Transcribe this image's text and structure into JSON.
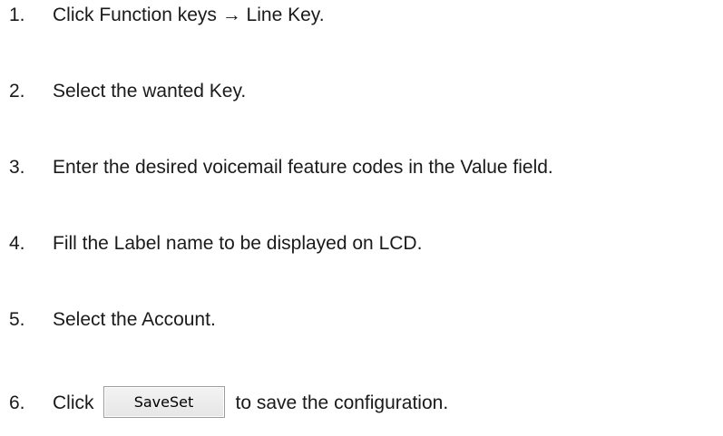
{
  "steps": [
    {
      "number": "1.",
      "text": "Click Function keys → Line Key."
    },
    {
      "number": "2.",
      "text": "Select the wanted Key."
    },
    {
      "number": "3.",
      "text": "Enter the desired voicemail feature codes in the Value field."
    },
    {
      "number": "4.",
      "text": "Fill the Label name to be displayed on LCD."
    },
    {
      "number": "5.",
      "text": "Select the Account."
    },
    {
      "number": "6.",
      "text_before": "Click",
      "button_label": "SaveSet",
      "text_after": "to save the configuration."
    }
  ]
}
